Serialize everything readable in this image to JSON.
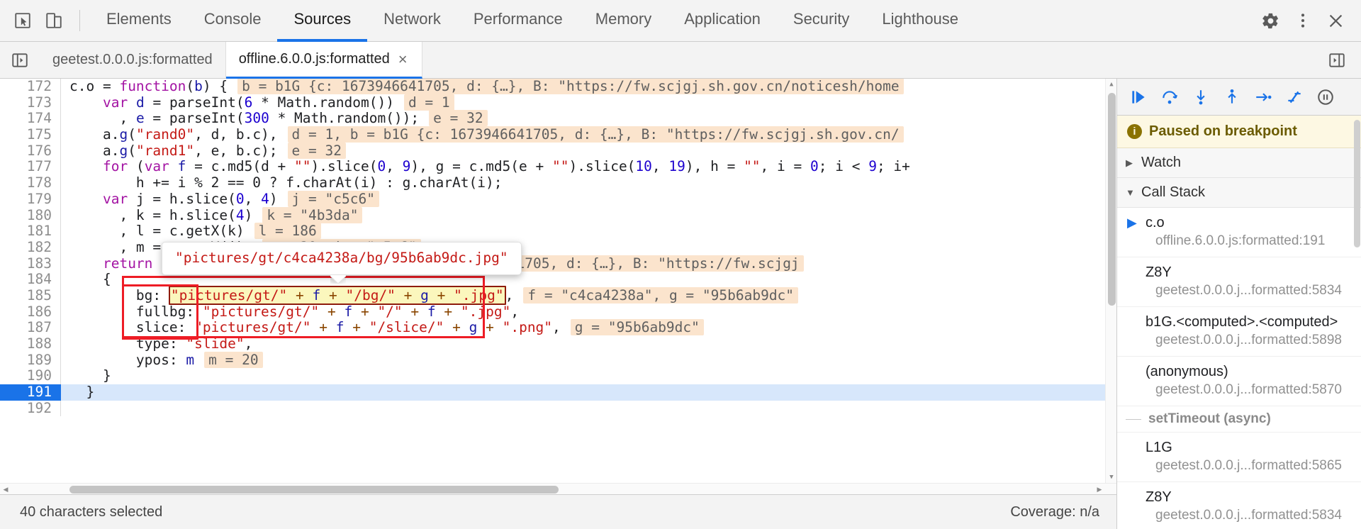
{
  "toolbar": {
    "inspect_icon": "inspect-element-icon",
    "device_icon": "device-toolbar-icon",
    "settings_icon": "gear-icon",
    "more_icon": "more-vertical-icon",
    "close_icon": "close-icon",
    "tabs": [
      {
        "label": "Elements",
        "active": false
      },
      {
        "label": "Console",
        "active": false
      },
      {
        "label": "Sources",
        "active": true
      },
      {
        "label": "Network",
        "active": false
      },
      {
        "label": "Performance",
        "active": false
      },
      {
        "label": "Memory",
        "active": false
      },
      {
        "label": "Application",
        "active": false
      },
      {
        "label": "Security",
        "active": false
      },
      {
        "label": "Lighthouse",
        "active": false
      }
    ]
  },
  "file_tabs": {
    "nav_toggle_icon": "show-navigator-icon",
    "more_tabs_icon": "show-more-tabs-icon",
    "items": [
      {
        "label": "geetest.0.0.0.js:formatted",
        "active": false,
        "closable": false
      },
      {
        "label": "offline.6.0.0.js:formatted",
        "active": true,
        "closable": true,
        "close_label": "×"
      }
    ]
  },
  "editor": {
    "lines": [
      {
        "num": "172",
        "exec": false
      },
      {
        "num": "173",
        "exec": false
      },
      {
        "num": "174",
        "exec": false
      },
      {
        "num": "175",
        "exec": false
      },
      {
        "num": "176",
        "exec": false
      },
      {
        "num": "177",
        "exec": false
      },
      {
        "num": "178",
        "exec": false
      },
      {
        "num": "179",
        "exec": false
      },
      {
        "num": "180",
        "exec": false
      },
      {
        "num": "181",
        "exec": false
      },
      {
        "num": "182",
        "exec": false
      },
      {
        "num": "183",
        "exec": false
      },
      {
        "num": "184",
        "exec": false
      },
      {
        "num": "185",
        "exec": false
      },
      {
        "num": "186",
        "exec": false
      },
      {
        "num": "187",
        "exec": false
      },
      {
        "num": "188",
        "exec": false
      },
      {
        "num": "189",
        "exec": false
      },
      {
        "num": "190",
        "exec": false
      },
      {
        "num": "191",
        "exec": true
      },
      {
        "num": "192",
        "exec": false
      }
    ],
    "code": {
      "l172": {
        "kw_fn": "function",
        "pre": "c.o = ",
        "paren_open": "(",
        "arg": "b",
        "paren_close": ") {",
        "hint": "b = b1G {c: 1673946641705, d: {…}, B: \"https://fw.scjgj.sh.gov.cn/noticesh/home"
      },
      "l173": {
        "kw": "var",
        "var": "d",
        "eq": " = ",
        "fn": "parseInt(",
        "num": "6",
        "rest": " * Math.random())",
        "hint": "d = 1"
      },
      "l174": {
        "lead": ", ",
        "var": "e",
        "eq": " = ",
        "fn": "parseInt(",
        "num": "300",
        "rest": " * Math.random());",
        "hint": "e = 32"
      },
      "l175": {
        "obj": "a.",
        "fn": "g",
        "p1": "(",
        "str": "\"rand0\"",
        "args": ", d, b.c),",
        "hint": "d = 1, b = b1G {c: 1673946641705, d: {…}, B: \"https://fw.scjgj.sh.gov.cn/"
      },
      "l176": {
        "obj": "a.",
        "fn": "g",
        "p1": "(",
        "str": "\"rand1\"",
        "args": ", e, b.c);",
        "hint": "e = 32"
      },
      "l177": {
        "kw_for": "for",
        "s1": " (",
        "kw_var": "var",
        "v1": " f",
        "s2": " = c.md5(d + ",
        "str1": "\"\"",
        "s3": ").slice(",
        "n0": "0",
        "s4": ", ",
        "n9": "9",
        "s5": "), g = c.md5(e + ",
        "str2": "\"\"",
        "s6": ").slice(",
        "n10": "10",
        "s7": ", ",
        "n19": "19",
        "s8": "), h = ",
        "str3": "\"\"",
        "s9": ", i = ",
        "ni": "0",
        "s10": "; i < ",
        "n9b": "9",
        "s11": "; i+"
      },
      "l178": {
        "text": "h += i % 2 == 0 ? f.charAt(i) : g.charAt(i);"
      },
      "l179": {
        "kw": "var",
        "rest": " j = h.slice(",
        "n0": "0",
        "sep": ", ",
        "n4": "4",
        "close": ")",
        "hint": "j = \"c5c6\""
      },
      "l180": {
        "text": ", k = h.slice(",
        "n4": "4",
        "close": ")",
        "hint": "k = \"4b3da\""
      },
      "l181": {
        "text": ", l = c.getX(k)",
        "hint": "l = 186"
      },
      "l182": {
        "text": ", m = c.getY(j);",
        "hint": "m = 20, j = \"c5c6\""
      },
      "l183": {
        "kw_return": "return",
        "rest": " c.render(b.c, b.d, {",
        "hint": "b = b1G {c: 1673946641705, d: {…}, B: \"https://fw.scjgj"
      },
      "l184": {
        "text": "{"
      },
      "l185": {
        "key": "bg: ",
        "expr_q1": "\"pictures/gt/\"",
        "expr_p1": " + ",
        "expr_f": "f",
        "expr_p2": " + ",
        "expr_q2": "\"/bg/\"",
        "expr_p3": " + ",
        "expr_g": "g",
        "expr_p4": " + ",
        "expr_q3": "\".jpg\"",
        "comma": ",",
        "hint": "f = \"c4ca4238a\", g = \"95b6ab9dc\""
      },
      "l186": {
        "key": "fullbg: ",
        "expr_q1": "\"pictures/gt/\"",
        "expr_p1": " + ",
        "expr_f": "f",
        "expr_p2": " + ",
        "expr_q2": "\"/\"",
        "expr_p3": " + ",
        "expr_f2": "f",
        "expr_p4": " + ",
        "expr_q3": "\".jpg\"",
        "comma": ","
      },
      "l187": {
        "key": "slice: ",
        "expr_q1": "\"pictures/gt/\"",
        "expr_p1": " + ",
        "expr_f": "f",
        "expr_p2": " + ",
        "expr_q2": "\"/slice/\"",
        "expr_p3": " + ",
        "expr_g": "g",
        "expr_p4": " + ",
        "expr_q3": "\".png\"",
        "comma": ",",
        "hint": "g = \"95b6ab9dc\""
      },
      "l188": {
        "key": "type: ",
        "str": "\"slide\"",
        "comma": ","
      },
      "l189": {
        "key": "ypos: ",
        "var": "m",
        "hint": "m = 20"
      },
      "l190": {
        "text": "}"
      },
      "l191": {
        "text": "}"
      },
      "l192": {
        "text": ""
      }
    },
    "tooltip": {
      "text": "\"pictures/gt/c4ca4238a/bg/95b6ab9dc.jpg\""
    }
  },
  "status_bar": {
    "selection_text": "40 characters selected",
    "coverage_text": "Coverage: n/a"
  },
  "debugger": {
    "toolbar_buttons": [
      {
        "name": "resume-script-execution",
        "icon": "resume-icon"
      },
      {
        "name": "step-over-next-function-call",
        "icon": "step-over-icon"
      },
      {
        "name": "step-into-next-function-call",
        "icon": "step-into-icon"
      },
      {
        "name": "step-out-of-current-function",
        "icon": "step-out-icon"
      },
      {
        "name": "step",
        "icon": "step-icon"
      },
      {
        "name": "deactivate-breakpoints",
        "icon": "deactivate-breakpoints-icon"
      },
      {
        "name": "pause-on-exceptions",
        "icon": "pause-icon"
      }
    ],
    "paused_banner": {
      "icon": "info-icon",
      "text": "Paused on breakpoint"
    },
    "sections": {
      "watch": {
        "label": "Watch",
        "expanded": false,
        "tri": "▶"
      },
      "call_stack": {
        "label": "Call Stack",
        "expanded": true,
        "tri": "▼"
      }
    },
    "call_stack": [
      {
        "fn": "c.o",
        "loc": "offline.6.0.0.js:formatted:191",
        "selected": true,
        "arrow": "▶"
      },
      {
        "fn": "Z8Y",
        "loc": "geetest.0.0.0.j...formatted:5834",
        "selected": false
      },
      {
        "fn": "b1G.<computed>.<computed>",
        "loc": "geetest.0.0.0.j...formatted:5898",
        "selected": false
      },
      {
        "fn": "(anonymous)",
        "loc": "geetest.0.0.0.j...formatted:5870",
        "selected": false
      },
      {
        "async_label": "setTimeout (async)"
      },
      {
        "fn": "L1G",
        "loc": "geetest.0.0.0.j...formatted:5865",
        "selected": false
      },
      {
        "fn": "Z8Y",
        "loc": "geetest.0.0.0.j...formatted:5834",
        "selected": false
      }
    ]
  }
}
